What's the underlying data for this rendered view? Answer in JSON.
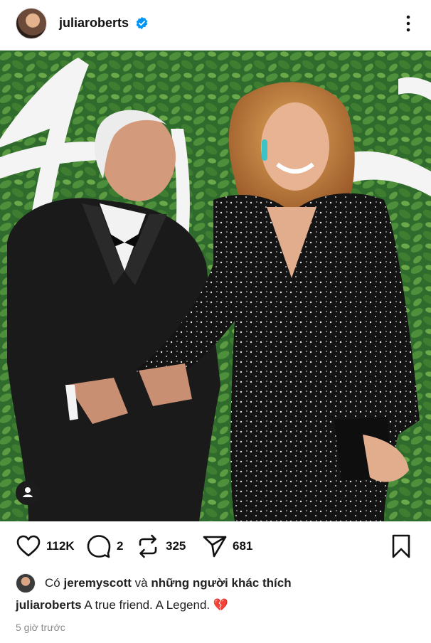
{
  "post": {
    "username": "juliaroberts",
    "verified": true,
    "more_icon": "more-vertical-icon",
    "photo_text": "Ar",
    "caption_user": "juliaroberts",
    "caption_text": "A true friend. A Legend. 💔",
    "time": "5 giờ trước"
  },
  "actions": {
    "likes": "112K",
    "comments": "2",
    "reposts": "325",
    "shares": "681"
  },
  "liked_by": {
    "prefix": "Có ",
    "user": "jeremyscott",
    "middle": " và ",
    "others": "những người khác thích"
  },
  "colors": {
    "verified_blue": "#0095f6",
    "text": "#111111",
    "muted": "#8a8a8a"
  }
}
